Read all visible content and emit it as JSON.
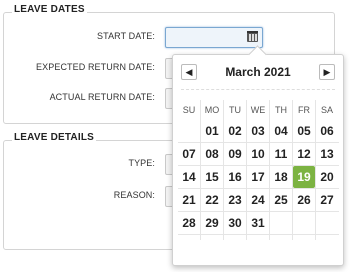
{
  "leave_dates": {
    "title": "LEAVE DATES",
    "start_label": "START DATE:",
    "expected_label": "EXPECTED RETURN DATE:",
    "actual_label": "ACTUAL RETURN DATE:"
  },
  "leave_details": {
    "title": "LEAVE DETAILS",
    "type_label": "TYPE:",
    "reason_label": "REASON:"
  },
  "datepicker": {
    "month_title": "March 2021",
    "prev_glyph": "◀",
    "next_glyph": "▶",
    "weekdays": [
      "SU",
      "MO",
      "TU",
      "WE",
      "TH",
      "FR",
      "SA"
    ],
    "weeks": [
      [
        "",
        "01",
        "02",
        "03",
        "04",
        "05",
        "06"
      ],
      [
        "07",
        "08",
        "09",
        "10",
        "11",
        "12",
        "13"
      ],
      [
        "14",
        "15",
        "16",
        "17",
        "18",
        "19",
        "20"
      ],
      [
        "21",
        "22",
        "23",
        "24",
        "25",
        "26",
        "27"
      ],
      [
        "28",
        "29",
        "30",
        "31",
        "",
        "",
        ""
      ]
    ],
    "highlighted_day": "19",
    "highlight_color": "#7cb342"
  }
}
